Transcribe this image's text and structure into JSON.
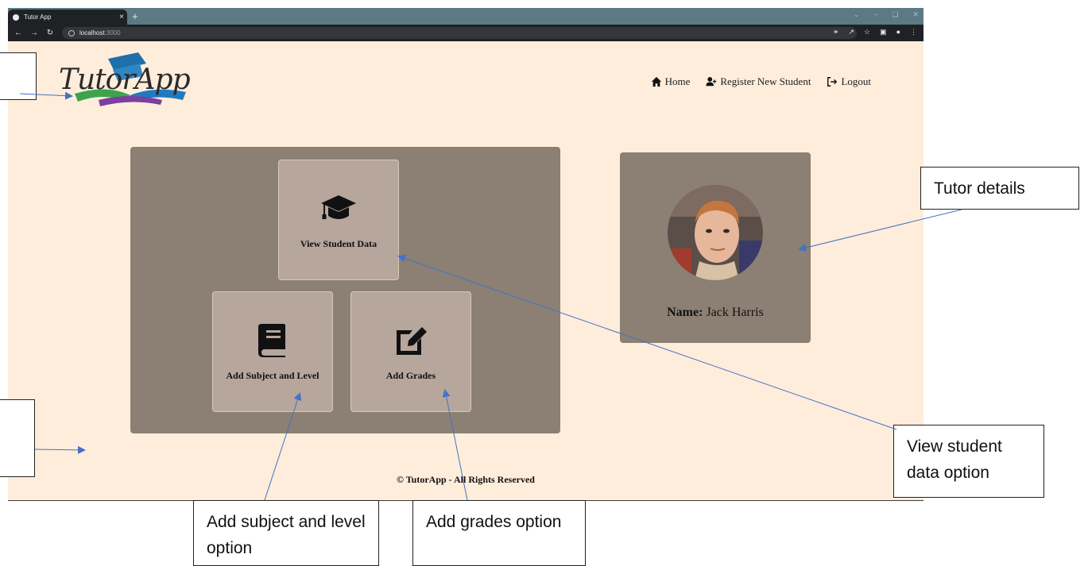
{
  "browser": {
    "tab_title": "Tutor App",
    "tab_close": "×",
    "new_tab": "+",
    "url_host": "localhost",
    "url_port": ":3000"
  },
  "app": {
    "logo_text": "TutorApp",
    "nav": [
      {
        "label": "Home",
        "icon": "home-icon"
      },
      {
        "label": "Register New Student",
        "icon": "user-plus-icon"
      },
      {
        "label": "Logout",
        "icon": "logout-icon"
      }
    ],
    "cards": {
      "view": {
        "label": "View Student Data",
        "icon": "graduation-cap-icon"
      },
      "subject": {
        "label": "Add Subject and Level",
        "icon": "book-icon"
      },
      "grades": {
        "label": "Add Grades",
        "icon": "edit-icon"
      }
    },
    "tutor": {
      "name_label": "Name:",
      "name_value": "Jack Harris"
    },
    "footer": "© TutorApp - All Rights Reserved"
  },
  "annotations": {
    "tutor_details": "Tutor details",
    "view_student": "View student data option",
    "add_subject": "Add subject and level option",
    "add_grades": "Add grades option"
  },
  "colors": {
    "page_bg": "#feeddb",
    "panel": "#8b8073",
    "card": "#b6a69c",
    "arrow": "#4472c4"
  }
}
